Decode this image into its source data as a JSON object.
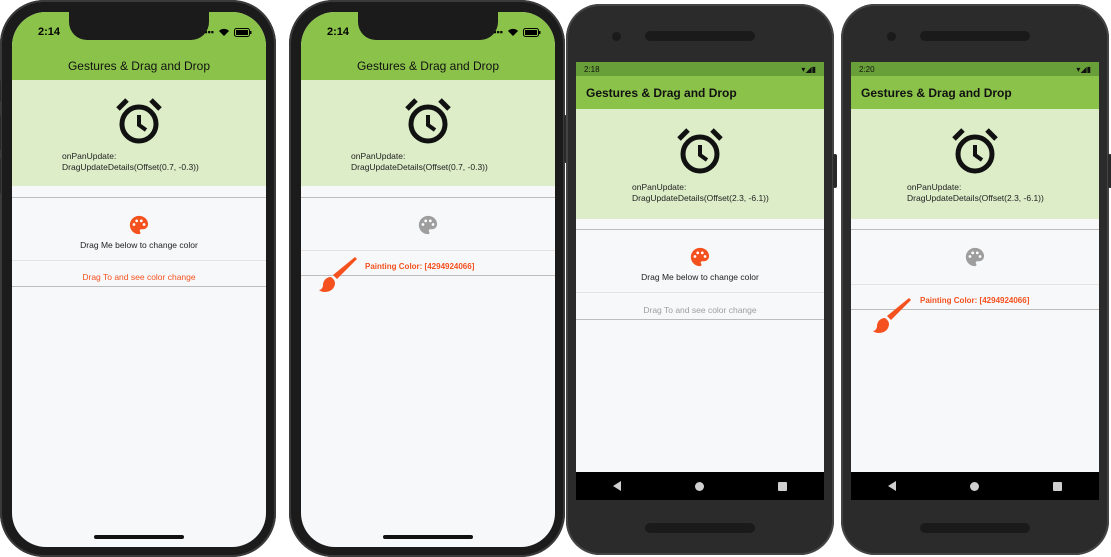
{
  "app": {
    "title": "Gestures & Drag and Drop"
  },
  "colors": {
    "appbar": "#8bc34a",
    "drag_area": "#dcedc8",
    "accent": "#f4511e",
    "palette_inactive": "#9e9e9e"
  },
  "phones": [
    {
      "status_time": "2:14",
      "pan_label": "onPanUpdate:",
      "pan_details": "DragUpdateDetails(Offset(0.7, -0.3))",
      "drag_label": "Drag Me below to change color",
      "target_label": "Drag To and see color change",
      "palette_icon": "palette-icon",
      "alarm_icon": "alarm-icon"
    },
    {
      "status_time": "2:14",
      "pan_label": "onPanUpdate:",
      "pan_details": "DragUpdateDetails(Offset(0.7, -0.3))",
      "painting_label": "Painting Color: [4294924066]",
      "palette_icon": "palette-icon",
      "brush_icon": "brush-icon"
    },
    {
      "status_time": "2:18",
      "pan_label": "onPanUpdate:",
      "pan_details": "DragUpdateDetails(Offset(2.3, -6.1))",
      "drag_label": "Drag Me below to change color",
      "target_label": "Drag To and see color change",
      "palette_icon": "palette-icon"
    },
    {
      "status_time": "2:20",
      "pan_label": "onPanUpdate:",
      "pan_details": "DragUpdateDetails(Offset(2.3, -6.1))",
      "painting_label": "Painting Color: [4294924066]",
      "palette_icon": "palette-icon",
      "brush_icon": "brush-icon"
    }
  ]
}
